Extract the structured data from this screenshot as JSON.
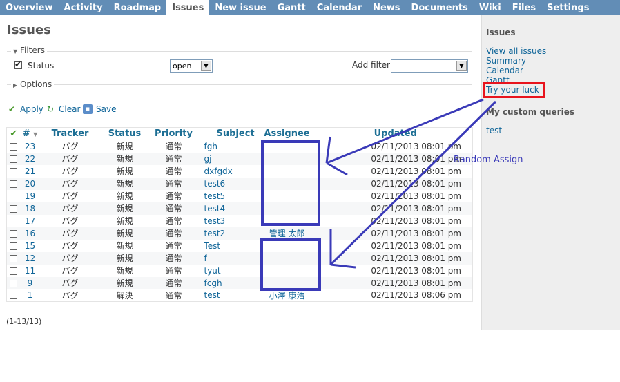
{
  "menu": {
    "tabs": [
      {
        "label": "Overview",
        "selected": false
      },
      {
        "label": "Activity",
        "selected": false
      },
      {
        "label": "Roadmap",
        "selected": false
      },
      {
        "label": "Issues",
        "selected": true
      },
      {
        "label": "New issue",
        "selected": false
      },
      {
        "label": "Gantt",
        "selected": false
      },
      {
        "label": "Calendar",
        "selected": false
      },
      {
        "label": "News",
        "selected": false
      },
      {
        "label": "Documents",
        "selected": false
      },
      {
        "label": "Wiki",
        "selected": false
      },
      {
        "label": "Files",
        "selected": false
      },
      {
        "label": "Settings",
        "selected": false
      }
    ]
  },
  "page": {
    "title": "Issues"
  },
  "filters": {
    "legend": "Filters",
    "status_label": "Status",
    "status_checked": true,
    "status_value": "open",
    "add_filter_label": "Add filter",
    "add_filter_value": ""
  },
  "options": {
    "legend": "Options"
  },
  "actions": {
    "apply": "Apply",
    "clear": "Clear",
    "save": "Save"
  },
  "table": {
    "headers": {
      "check": "✔",
      "id": "#",
      "tracker": "Tracker",
      "status": "Status",
      "priority": "Priority",
      "subject": "Subject",
      "assignee": "Assignee",
      "updated": "Updated"
    },
    "rows": [
      {
        "id": "23",
        "tracker": "バグ",
        "status": "新規",
        "priority": "通常",
        "subject": "fgh",
        "assignee": "",
        "updated": "02/11/2013 08:01 pm"
      },
      {
        "id": "22",
        "tracker": "バグ",
        "status": "新規",
        "priority": "通常",
        "subject": "gj",
        "assignee": "",
        "updated": "02/11/2013 08:01 pm"
      },
      {
        "id": "21",
        "tracker": "バグ",
        "status": "新規",
        "priority": "通常",
        "subject": "dxfgdx",
        "assignee": "",
        "updated": "02/11/2013 08:01 pm"
      },
      {
        "id": "20",
        "tracker": "バグ",
        "status": "新規",
        "priority": "通常",
        "subject": "test6",
        "assignee": "",
        "updated": "02/11/2013 08:01 pm"
      },
      {
        "id": "19",
        "tracker": "バグ",
        "status": "新規",
        "priority": "通常",
        "subject": "test5",
        "assignee": "",
        "updated": "02/11/2013 08:01 pm"
      },
      {
        "id": "18",
        "tracker": "バグ",
        "status": "新規",
        "priority": "通常",
        "subject": "test4",
        "assignee": "",
        "updated": "02/11/2013 08:01 pm"
      },
      {
        "id": "17",
        "tracker": "バグ",
        "status": "新規",
        "priority": "通常",
        "subject": "test3",
        "assignee": "",
        "updated": "02/11/2013 08:01 pm"
      },
      {
        "id": "16",
        "tracker": "バグ",
        "status": "新規",
        "priority": "通常",
        "subject": "test2",
        "assignee": "管理 太郎",
        "updated": "02/11/2013 08:01 pm"
      },
      {
        "id": "15",
        "tracker": "バグ",
        "status": "新規",
        "priority": "通常",
        "subject": "Test",
        "assignee": "",
        "updated": "02/11/2013 08:01 pm"
      },
      {
        "id": "12",
        "tracker": "バグ",
        "status": "新規",
        "priority": "通常",
        "subject": "f",
        "assignee": "",
        "updated": "02/11/2013 08:01 pm"
      },
      {
        "id": "11",
        "tracker": "バグ",
        "status": "新規",
        "priority": "通常",
        "subject": "tyut",
        "assignee": "",
        "updated": "02/11/2013 08:01 pm"
      },
      {
        "id": "9",
        "tracker": "バグ",
        "status": "新規",
        "priority": "通常",
        "subject": "fcgh",
        "assignee": "",
        "updated": "02/11/2013 08:01 pm"
      },
      {
        "id": "1",
        "tracker": "バグ",
        "status": "解決",
        "priority": "通常",
        "subject": "test",
        "assignee": "小澤 康浩",
        "updated": "02/11/2013 08:06 pm"
      }
    ]
  },
  "pager": {
    "text": "(1-13/13)"
  },
  "sidebar": {
    "issues_heading": "Issues",
    "links": [
      "View all issues",
      "Summary",
      "Calendar",
      "Gantt",
      "Try your luck"
    ],
    "custom_heading": "My custom queries",
    "custom_queries": [
      "test"
    ]
  },
  "annotation": {
    "note": "Random Assign",
    "highlight_color": "#e8141d",
    "arrow_color": "#3a3ab8"
  }
}
